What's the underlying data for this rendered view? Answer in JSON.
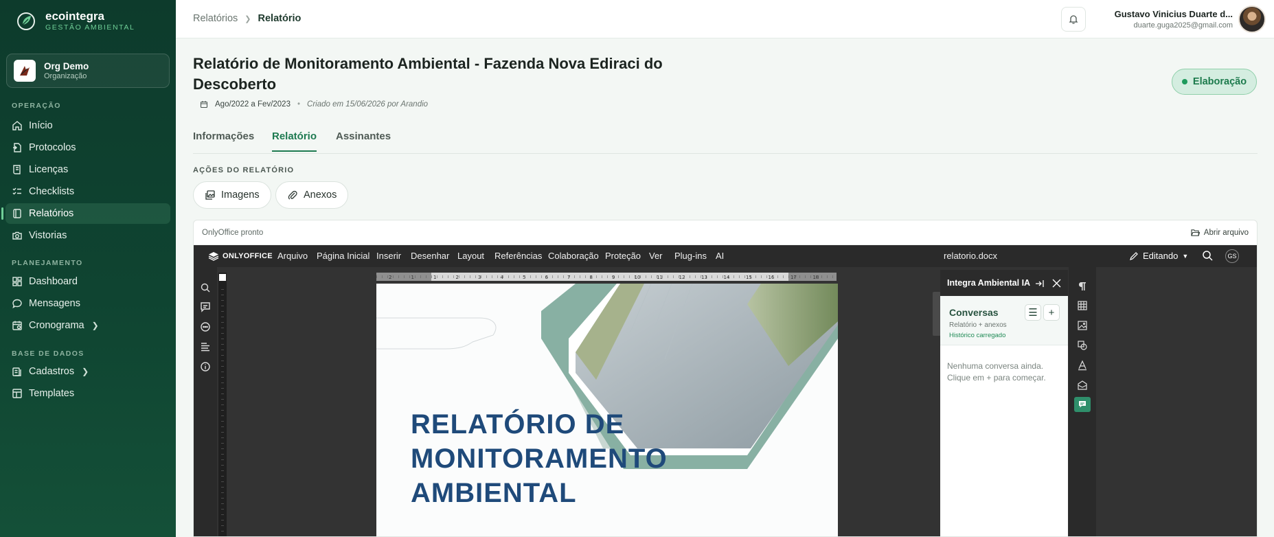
{
  "brand": {
    "name": "ecointegra",
    "subtitle": "GESTÃO AMBIENTAL"
  },
  "org": {
    "name": "Org Demo",
    "type": "Organização"
  },
  "sidebar": {
    "sections": [
      {
        "label": "OPERAÇÃO"
      },
      {
        "label": "PLANEJAMENTO"
      },
      {
        "label": "BASE DE DADOS"
      }
    ],
    "items": [
      {
        "label": "Início",
        "icon": "home-icon"
      },
      {
        "label": "Protocolos",
        "icon": "protocol-icon"
      },
      {
        "label": "Licenças",
        "icon": "license-icon"
      },
      {
        "label": "Checklists",
        "icon": "checklist-icon"
      },
      {
        "label": "Relatórios",
        "icon": "report-icon",
        "active": true
      },
      {
        "label": "Vistorias",
        "icon": "camera-icon"
      },
      {
        "label": "Dashboard",
        "icon": "dashboard-icon"
      },
      {
        "label": "Mensagens",
        "icon": "message-icon"
      },
      {
        "label": "Cronograma",
        "icon": "calendar-icon"
      },
      {
        "label": "Cadastros",
        "icon": "database-icon"
      },
      {
        "label": "Templates",
        "icon": "template-icon"
      }
    ]
  },
  "header": {
    "breadcrumb": {
      "parent": "Relatórios",
      "current": "Relatório"
    },
    "user": {
      "name": "Gustavo Vinicius Duarte d...",
      "email": "duarte.guga2025@gmail.com"
    }
  },
  "report": {
    "title": "Relatório de Monitoramento Ambiental - Fazenda Nova Ediraci do Descoberto",
    "period": "Ago/2022 a Fev/2023",
    "created": "Criado em 15/06/2026 por Arandio",
    "status": "Elaboração"
  },
  "tabs": [
    {
      "label": "Informações"
    },
    {
      "label": "Relatório",
      "active": true
    },
    {
      "label": "Assinantes"
    }
  ],
  "actions": {
    "label": "AÇÕES DO RELATÓRIO",
    "images": "Imagens",
    "attachments": "Anexos"
  },
  "editor": {
    "status": "OnlyOffice pronto",
    "open_file": "Abrir arquivo",
    "logo": "ONLYOFFICE",
    "menu": [
      "Arquivo",
      "Página Inicial",
      "Inserir",
      "Desenhar",
      "Layout",
      "Referências",
      "Colaboração",
      "Proteção",
      "Ver",
      "Plug-ins",
      "AI"
    ],
    "doc_name": "relatorio.docx",
    "mode": "Editando",
    "user_initials": "GS",
    "cover_title_lines": [
      "RELATÓRIO DE",
      "MONITORAMENTO",
      "AMBIENTAL"
    ],
    "ruler_marks": [
      "2",
      "1",
      "1",
      "2",
      "3",
      "4",
      "5",
      "6",
      "7",
      "8",
      "9",
      "10",
      "11",
      "12",
      "13",
      "14",
      "15",
      "16",
      "17",
      "18"
    ]
  },
  "ai_panel": {
    "title": "Integra Ambiental IA",
    "conversations": "Conversas",
    "subtitle": "Relatório + anexos",
    "history": "Histórico carregado",
    "empty": "Nenhuma conversa ainda. Clique em + para começar."
  },
  "colors": {
    "sidebar": "#0f4431",
    "accent": "#1d7a50",
    "status_bg": "#d4ede0",
    "cover_title": "#1f4a7a"
  }
}
